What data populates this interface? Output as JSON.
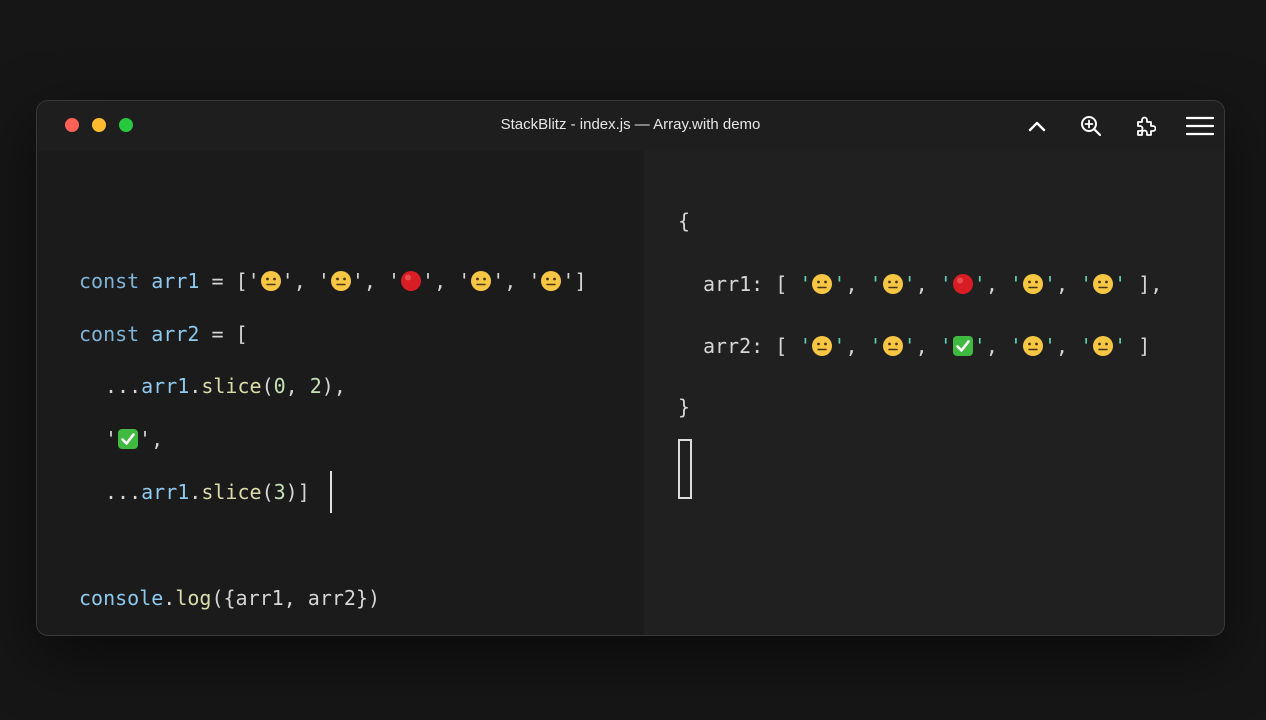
{
  "window": {
    "title": "StackBlitz - index.js — Array.with demo",
    "traffic_lights": {
      "close": "#ff5f57",
      "minimize": "#febc2e",
      "maximize": "#28c840"
    },
    "toolbar_icons": [
      "chevron-up-icon",
      "zoom-in-icon",
      "puzzle-icon",
      "hamburger-menu-icon"
    ]
  },
  "editor": {
    "line1": {
      "kw": "const",
      "name": "arr1",
      "op": "=",
      "open": "[",
      "close": "]",
      "sep": ",",
      "quote": "'",
      "items": [
        "neutral-face",
        "neutral-face",
        "red-circle",
        "neutral-face",
        "neutral-face"
      ]
    },
    "line2": {
      "kw": "const",
      "name": "arr2",
      "op": "=",
      "open": "["
    },
    "line3": {
      "spread": "...",
      "obj": "arr1",
      "dot": ".",
      "fn": "slice",
      "args_open": "(",
      "a1": "0",
      "comma": ",",
      "a2": "2",
      "args_close": ")",
      "trail": ","
    },
    "line4": {
      "quote": "'",
      "item": "check-mark",
      "trail": ","
    },
    "line5": {
      "spread": "...",
      "obj": "arr1",
      "dot": ".",
      "fn": "slice",
      "args_open": "(",
      "a1": "3",
      "args_close": ")",
      "close": "]"
    },
    "line6": {
      "obj": "console",
      "dot": ".",
      "fn": "log",
      "text": "({arr1, arr2})"
    }
  },
  "console": {
    "open_brace": "{",
    "close_brace": "}",
    "arr1_key": "arr1:",
    "arr2_key": "arr2:",
    "open": "[",
    "close": "]",
    "sep": ",",
    "quote": "'",
    "arr1_items": [
      "neutral-face",
      "neutral-face",
      "red-circle",
      "neutral-face",
      "neutral-face"
    ],
    "arr2_items": [
      "neutral-face",
      "neutral-face",
      "check-mark",
      "neutral-face",
      "neutral-face"
    ]
  }
}
